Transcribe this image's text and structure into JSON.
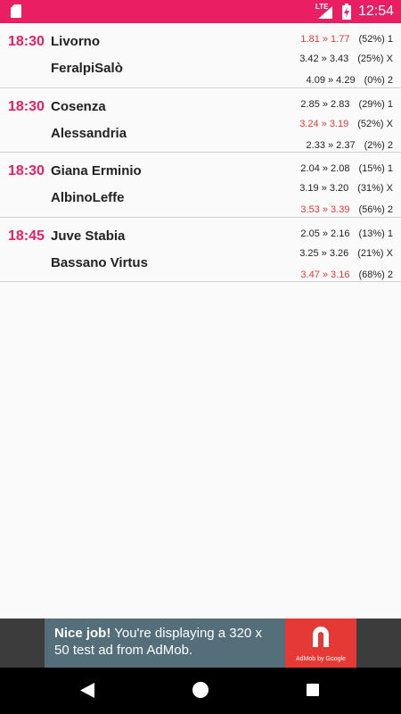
{
  "status_bar": {
    "network": "LTE",
    "time": "12:54"
  },
  "matches": [
    {
      "time": "18:30",
      "home": "Livorno",
      "away": "FeralpiSalò",
      "odds": [
        {
          "value": "1.81 » 1.77",
          "pct": "(52%) 1",
          "highlight": true
        },
        {
          "value": "3.42 » 3.43",
          "pct": "(25%) X",
          "highlight": false
        },
        {
          "value": "4.09 » 4.29",
          "pct": "(0%) 2",
          "highlight": false
        }
      ]
    },
    {
      "time": "18:30",
      "home": "Cosenza",
      "away": "Alessandria",
      "odds": [
        {
          "value": "2.85 » 2.83",
          "pct": "(29%) 1",
          "highlight": false
        },
        {
          "value": "3.24 » 3.19",
          "pct": "(52%) X",
          "highlight": true
        },
        {
          "value": "2.33 » 2.37",
          "pct": "(2%) 2",
          "highlight": false
        }
      ]
    },
    {
      "time": "18:30",
      "home": "Giana Erminio",
      "away": "AlbinoLeffe",
      "odds": [
        {
          "value": "2.04 » 2.08",
          "pct": "(15%) 1",
          "highlight": false
        },
        {
          "value": "3.19 » 3.20",
          "pct": "(31%) X",
          "highlight": false
        },
        {
          "value": "3.53 » 3.39",
          "pct": "(56%) 2",
          "highlight": true
        }
      ]
    },
    {
      "time": "18:45",
      "home": "Juve Stabia",
      "away": "Bassano Virtus",
      "odds": [
        {
          "value": "2.05 » 2.16",
          "pct": "(13%) 1",
          "highlight": false
        },
        {
          "value": "3.25 » 3.26",
          "pct": "(21%) X",
          "highlight": false
        },
        {
          "value": "3.47 » 3.16",
          "pct": "(68%) 2",
          "highlight": true
        }
      ]
    }
  ],
  "ad": {
    "headline": "Nice job!",
    "body": " You're displaying a 320 x 50 test ad from AdMob.",
    "brand": "AdMob by Google"
  },
  "colors": {
    "accent": "#e91e63",
    "highlight": "#e53935"
  },
  "icons": {
    "status": [
      "sd-card-icon",
      "signal-icon",
      "battery-charging-icon"
    ],
    "nav": [
      "back-icon",
      "home-icon",
      "recents-icon"
    ],
    "ad": "admob-logo-icon"
  }
}
